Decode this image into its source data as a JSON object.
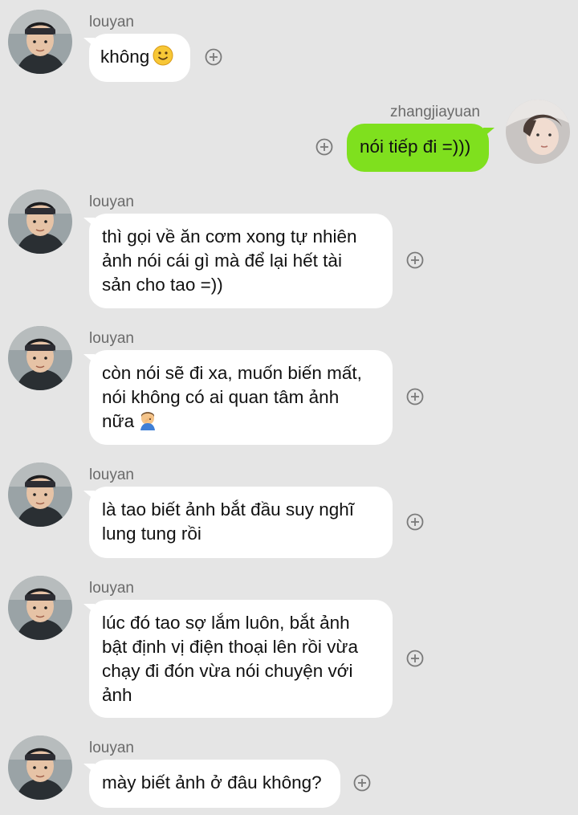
{
  "contacts": {
    "friend_name": "louyan",
    "self_name": "zhangjiayuan"
  },
  "icons": {
    "add": "add-circle-icon",
    "smile": "smiling-face-emoji",
    "facepalm": "facepalm-emoji"
  },
  "colors": {
    "background": "#e5e5e5",
    "incoming_bubble": "#ffffff",
    "outgoing_bubble": "#7fe01e"
  },
  "messages": [
    {
      "sender": "louyan",
      "text": "không"
    },
    {
      "sender": "zhangjiayuan",
      "text": "nói tiếp đi =)))"
    },
    {
      "sender": "louyan",
      "lines": [
        "thì gọi về ăn cơm xong tự nhiên",
        "ảnh nói cái gì mà để lại hết tài",
        "sản cho tao =))"
      ]
    },
    {
      "sender": "louyan",
      "lines": [
        "còn nói sẽ đi xa, muốn biến mất,",
        "nói không có ai quan tâm ảnh",
        "nữa"
      ]
    },
    {
      "sender": "louyan",
      "lines": [
        "là tao biết ảnh bắt đầu suy nghĩ",
        "lung tung rồi"
      ]
    },
    {
      "sender": "louyan",
      "lines": [
        "lúc đó tao sợ lắm luôn, bắt ảnh",
        "bật định vị điện thoại lên rồi vừa",
        "chạy đi đón vừa nói chuyện với",
        "ảnh"
      ]
    },
    {
      "sender": "louyan",
      "text": "mày biết ảnh ở đâu không?"
    }
  ]
}
